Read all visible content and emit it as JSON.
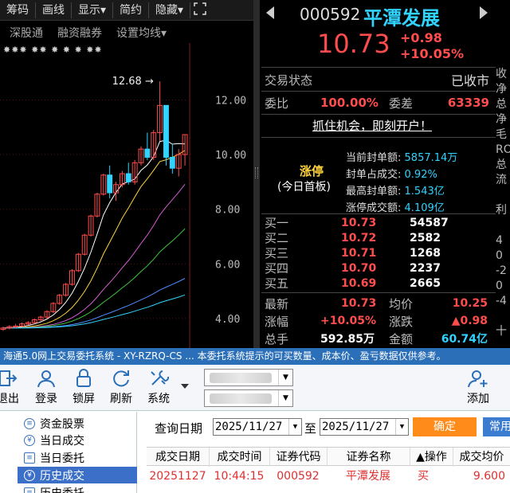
{
  "toolbar": {
    "items": [
      "筹码",
      "画线",
      "显示▾",
      "简约",
      "隐藏▾"
    ],
    "sub": [
      "深股通",
      "融资融券",
      "设置均线▾"
    ],
    "markers": "✸✸✸ ✸✸ ✸ ✸ ✸ ✸✸"
  },
  "chart_data": {
    "type": "candlestick",
    "yticks": [
      "12.00",
      "10.00",
      "8.00",
      "6.00",
      "4.00"
    ],
    "ylim": [
      3.5,
      13.5
    ],
    "high_label": "12.68",
    "candles": [
      [
        3.6,
        3.7,
        3.55,
        3.65
      ],
      [
        3.65,
        3.75,
        3.6,
        3.7
      ],
      [
        3.7,
        3.8,
        3.65,
        3.72
      ],
      [
        3.72,
        3.85,
        3.7,
        3.8
      ],
      [
        3.8,
        3.9,
        3.75,
        3.85
      ],
      [
        3.85,
        4.0,
        3.8,
        3.95
      ],
      [
        3.95,
        4.1,
        3.9,
        4.05
      ],
      [
        4.05,
        4.3,
        4.0,
        4.25
      ],
      [
        4.25,
        4.6,
        4.2,
        4.55
      ],
      [
        4.55,
        4.9,
        4.5,
        4.85
      ],
      [
        4.85,
        5.3,
        4.8,
        5.25
      ],
      [
        5.25,
        5.8,
        5.2,
        5.75
      ],
      [
        5.75,
        6.4,
        5.7,
        6.35
      ],
      [
        6.35,
        7.1,
        6.3,
        7.05
      ],
      [
        7.05,
        7.8,
        7.0,
        7.75
      ],
      [
        7.75,
        8.6,
        7.7,
        8.55
      ],
      [
        8.55,
        9.3,
        8.5,
        9.25
      ],
      [
        9.25,
        9.6,
        8.4,
        8.6
      ],
      [
        8.6,
        9.0,
        8.3,
        8.9
      ],
      [
        8.9,
        9.4,
        8.8,
        9.3
      ],
      [
        9.3,
        9.7,
        8.9,
        9.0
      ],
      [
        9.0,
        9.8,
        8.9,
        9.7
      ],
      [
        9.7,
        10.3,
        9.6,
        10.2
      ],
      [
        10.2,
        10.8,
        9.8,
        9.9
      ],
      [
        9.9,
        10.9,
        9.8,
        10.8
      ],
      [
        10.8,
        12.68,
        10.5,
        11.8
      ],
      [
        11.8,
        11.0,
        9.6,
        9.9
      ],
      [
        9.9,
        10.4,
        9.3,
        9.5
      ],
      [
        9.5,
        10.2,
        9.2,
        10.0
      ],
      [
        10.0,
        10.73,
        9.6,
        10.73
      ]
    ]
  },
  "quote": {
    "code": "000592",
    "name": "平潭发展",
    "price": "10.73",
    "change": "+0.98",
    "change_pct": "+10.05%",
    "status_label": "交易状态",
    "status_value": "已收市",
    "weibi_label": "委比",
    "weibi_value": "100.00%",
    "weicha_label": "委差",
    "weicha_value": "63339",
    "promo": "抓住机会，即刻开户！",
    "limit_title": "涨停",
    "limit_sub": "(今日首板)",
    "limit_rows": [
      {
        "label": "当前封单额:",
        "value": "5857.14万"
      },
      {
        "label": "封单占成交:",
        "value": "0.92%"
      },
      {
        "label": "最高封单额:",
        "value": "1.543亿"
      },
      {
        "label": "涨停成交额:",
        "value": "4.109亿"
      }
    ],
    "bids": [
      {
        "label": "买一",
        "price": "10.73",
        "vol": "54587"
      },
      {
        "label": "买二",
        "price": "10.72",
        "vol": "2582"
      },
      {
        "label": "买三",
        "price": "10.71",
        "vol": "1268"
      },
      {
        "label": "买四",
        "price": "10.70",
        "vol": "2237"
      },
      {
        "label": "买五",
        "price": "10.69",
        "vol": "2665"
      }
    ],
    "latest_label": "最新",
    "latest_value": "10.73",
    "avg_label": "均价",
    "avg_value": "10.25",
    "pct_label": "涨幅",
    "pct_value": "+10.05%",
    "chg_label": "涨跌",
    "chg_value": "▲0.98",
    "total_label": "总手",
    "total_value": "592.85万",
    "amount_label": "金额",
    "amount_value": "60.74亿",
    "right_strip": [
      "收",
      "净",
      "总",
      "净",
      "毛",
      "RO",
      "总",
      "流",
      "",
      "利",
      "",
      "4",
      "0",
      "-2",
      "0",
      "-4",
      "",
      "十"
    ]
  },
  "app": {
    "title": "海通5.0网上交易委托系统 - XY-RZRQ-CS  ... 本委托系统提示的可买数量、成本价、盈亏数据仅供参考。",
    "buttons": [
      "退出",
      "登录",
      "锁屏",
      "刷新",
      "系统"
    ],
    "add_label": "添加",
    "tree": [
      "资金股票",
      "当日成交",
      "当日委托",
      "历史成交",
      "历史委托"
    ],
    "query_label": "查询日期",
    "date_from": "2025/11/27",
    "to_label": "至",
    "date_to": "2025/11/27",
    "ok_label": "确定",
    "common_label": "常用",
    "headers": [
      "成交日期",
      "成交时间",
      "证券代码",
      "证券名称",
      "▲操作",
      "成交均价"
    ],
    "rows": [
      [
        "20251127",
        "10:44:15",
        "000592",
        "平潭发展",
        "买",
        "9.600"
      ]
    ]
  }
}
